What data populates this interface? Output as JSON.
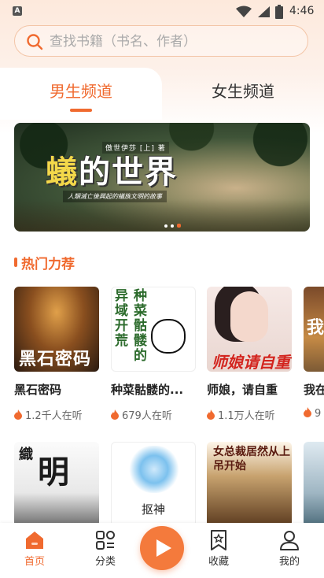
{
  "status_bar": {
    "time": "4:46"
  },
  "search": {
    "placeholder": "查找书籍（书名、作者）"
  },
  "tabs": [
    {
      "label": "男生频道",
      "active": true
    },
    {
      "label": "女生频道",
      "active": false
    }
  ],
  "banner": {
    "title_highlight": "蟻",
    "title_rest": "的世界",
    "author": "傲世伊莎 [上] 著",
    "subtitle": "人類滅亡後興起的蟻族文明的故事",
    "page_count": 3,
    "active_page": 3
  },
  "section": {
    "title": "热门力荐"
  },
  "books_row1": [
    {
      "title": "黑石密码",
      "listeners": "1.2千人在听",
      "cover_text": "黑石密码"
    },
    {
      "title": "种菜骷髅的...",
      "listeners": "679人在听",
      "cover_text_a": "异域开荒",
      "cover_text_b": "种菜骷髅的"
    },
    {
      "title": "师娘，请自重",
      "listeners": "1.1万人在听",
      "cover_text": "师娘请自重"
    },
    {
      "title": "我在",
      "listeners": "9",
      "cover_text": "我"
    }
  ],
  "books_row2": [
    {
      "cover_text_a": "織",
      "cover_text_b": "明"
    },
    {
      "cover_text": "抠神"
    },
    {
      "cover_text": "女总裁居然从上吊开始"
    },
    {
      "cover_text": ""
    }
  ],
  "bottom_nav": [
    {
      "label": "首页",
      "icon": "home-icon",
      "active": true
    },
    {
      "label": "分类",
      "icon": "category-icon",
      "active": false
    },
    {
      "label": "收藏",
      "icon": "bookmark-icon",
      "active": false
    },
    {
      "label": "我的",
      "icon": "profile-icon",
      "active": false
    }
  ],
  "colors": {
    "accent": "#f06a2f",
    "play": "#f47a3c"
  }
}
